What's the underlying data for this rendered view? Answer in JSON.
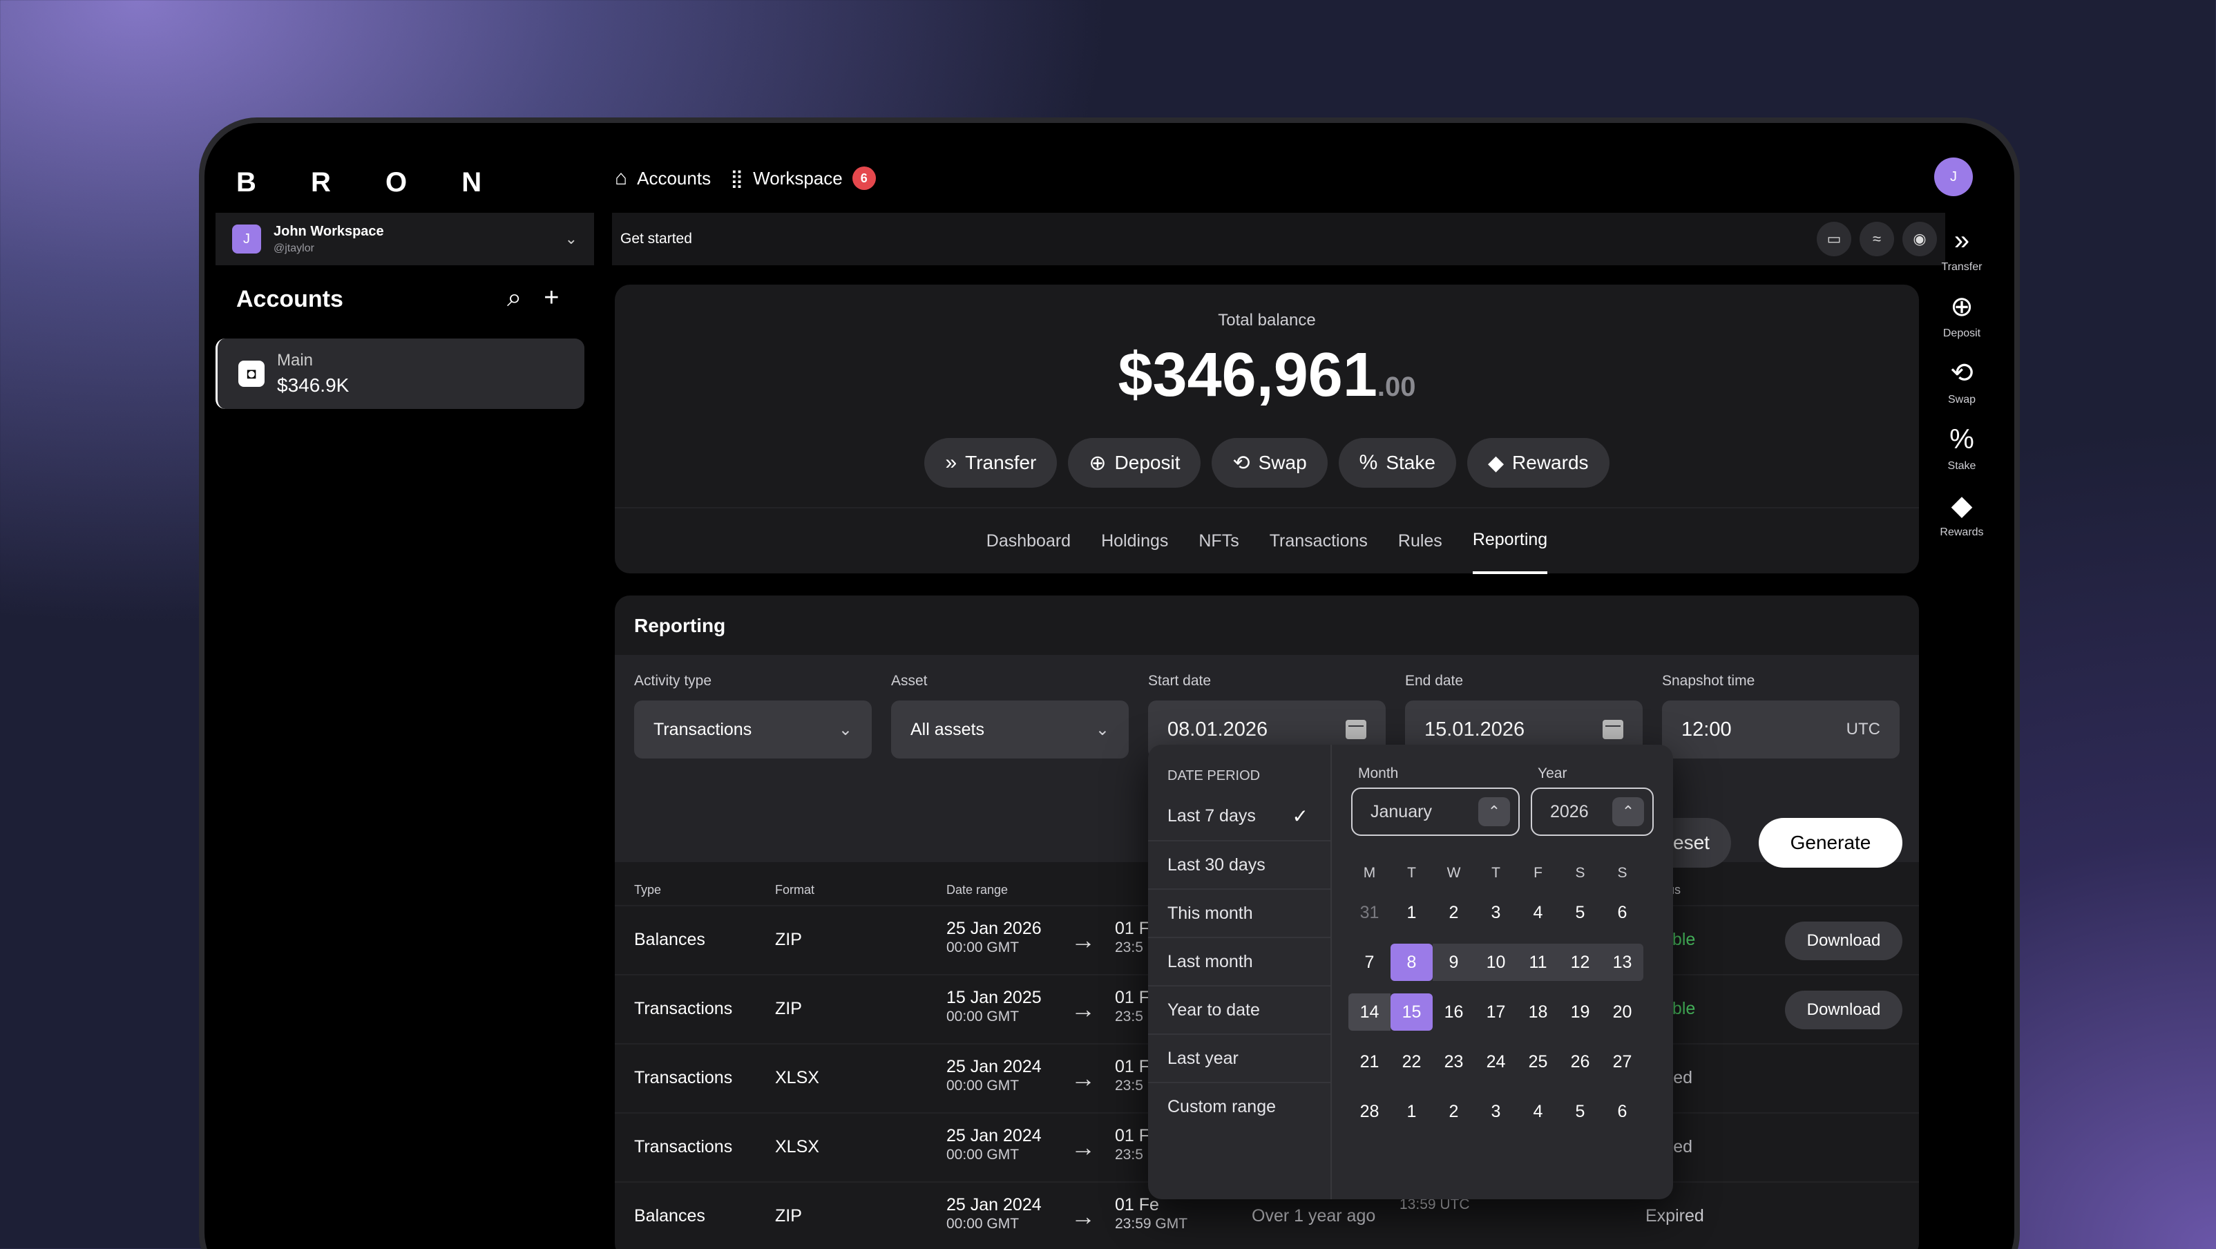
{
  "brand": "B R O N",
  "topnav": {
    "accounts": "Accounts",
    "workspace": "Workspace",
    "workspace_badge": "6",
    "avatar_initial": "J"
  },
  "workspace_switcher": {
    "initial": "J",
    "name": "John Workspace",
    "handle": "@jtaylor"
  },
  "get_started": "Get started",
  "sidebar": {
    "title": "Accounts",
    "account": {
      "name": "Main",
      "value": "$346.9K"
    }
  },
  "right_actions": [
    {
      "label": "Transfer",
      "icon": "transfer-icon"
    },
    {
      "label": "Deposit",
      "icon": "deposit-icon"
    },
    {
      "label": "Swap",
      "icon": "swap-icon"
    },
    {
      "label": "Stake",
      "icon": "stake-icon"
    },
    {
      "label": "Rewards",
      "icon": "rewards-icon"
    }
  ],
  "balance": {
    "label": "Total balance",
    "whole": "$346,961",
    "cents": ".00"
  },
  "actions": [
    "Transfer",
    "Deposit",
    "Swap",
    "Stake",
    "Rewards"
  ],
  "tabs": [
    "Dashboard",
    "Holdings",
    "NFTs",
    "Transactions",
    "Rules",
    "Reporting"
  ],
  "active_tab": "Reporting",
  "reporting": {
    "title": "Reporting",
    "activity_type": {
      "label": "Activity type",
      "value": "Transactions"
    },
    "asset": {
      "label": "Asset",
      "value": "All assets"
    },
    "start_date": {
      "label": "Start date",
      "value": "08.01.2026"
    },
    "end_date": {
      "label": "End date",
      "value": "15.01.2026"
    },
    "snapshot": {
      "label": "Snapshot time",
      "value": "12:00",
      "tz": "UTC"
    },
    "reset": "eset",
    "generate": "Generate",
    "headers": {
      "type": "Type",
      "format": "Format",
      "date_range": "Date range",
      "status": "Status"
    },
    "rows": [
      {
        "type": "Balances",
        "format": "ZIP",
        "from_date": "25 Jan 2026",
        "from_time": "00:00 GMT",
        "to_date": "01 F",
        "to_time": "23:5",
        "created": "",
        "snapshot": "",
        "status": "ailable",
        "download": "Download"
      },
      {
        "type": "Transactions",
        "format": "ZIP",
        "from_date": "15 Jan 2025",
        "from_time": "00:00 GMT",
        "to_date": "01 F",
        "to_time": "23:5",
        "created": "",
        "snapshot": "",
        "status": "ailable",
        "download": "Download"
      },
      {
        "type": "Transactions",
        "format": "XLSX",
        "from_date": "25 Jan 2024",
        "from_time": "00:00 GMT",
        "to_date": "01 F",
        "to_time": "23:5",
        "created": "",
        "snapshot": "",
        "status": "xpired",
        "download": ""
      },
      {
        "type": "Transactions",
        "format": "XLSX",
        "from_date": "25 Jan 2024",
        "from_time": "00:00 GMT",
        "to_date": "01 F",
        "to_time": "23:5",
        "created": "",
        "snapshot": "",
        "status": "xpired",
        "download": ""
      },
      {
        "type": "Balances",
        "format": "ZIP",
        "from_date": "25 Jan 2024",
        "from_time": "00:00 GMT",
        "to_date": "01 Fe",
        "to_time": "23:59 GMT",
        "created": "Over 1 year ago",
        "snapshot": "13:59 UTC",
        "status": "Expired",
        "download": ""
      }
    ]
  },
  "date_picker": {
    "period_header": "DATE PERIOD",
    "periods": [
      "Last 7 days",
      "Last 30 days",
      "This month",
      "Last month",
      "Year to date",
      "Last year",
      "Custom range"
    ],
    "selected_period": "Last 7 days",
    "month_label": "Month",
    "month": "January",
    "year_label": "Year",
    "year": "2026",
    "weekdays": [
      "M",
      "T",
      "W",
      "T",
      "F",
      "S",
      "S"
    ],
    "weeks": [
      [
        "31",
        "1",
        "2",
        "3",
        "4",
        "5",
        "6"
      ],
      [
        "7",
        "8",
        "9",
        "10",
        "11",
        "12",
        "13"
      ],
      [
        "14",
        "15",
        "16",
        "17",
        "18",
        "19",
        "20"
      ],
      [
        "21",
        "22",
        "23",
        "24",
        "25",
        "26",
        "27"
      ],
      [
        "28",
        "1",
        "2",
        "3",
        "4",
        "5",
        "6"
      ]
    ],
    "selected_start": "8",
    "selected_end": "15"
  },
  "colors": {
    "accent": "#9b7be8",
    "available": "#4cc764",
    "badge": "#e5484d"
  }
}
